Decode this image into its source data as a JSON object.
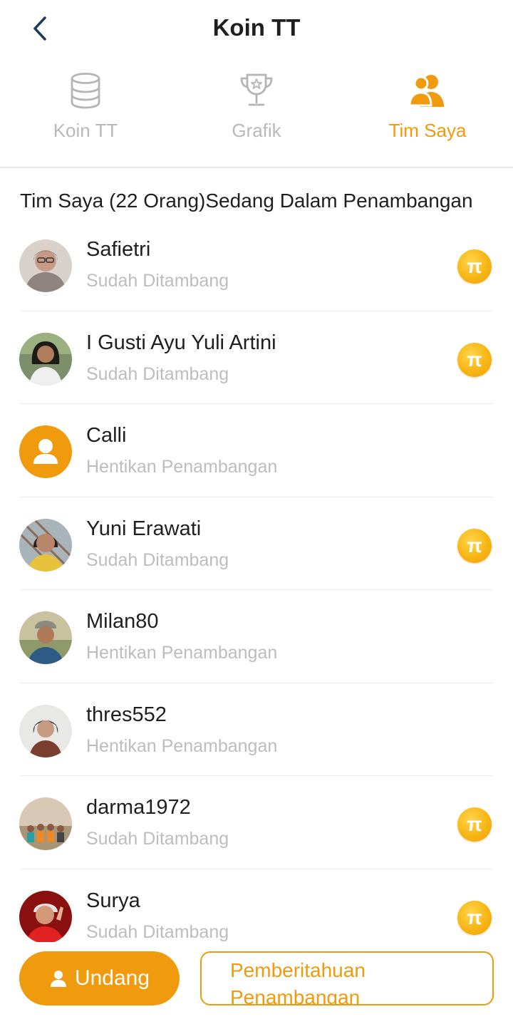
{
  "header": {
    "title": "Koin TT",
    "back_icon": "chevron-left-icon"
  },
  "tabs": [
    {
      "label": "Koin TT",
      "icon": "database-icon",
      "active": false
    },
    {
      "label": "Grafik",
      "icon": "trophy-icon",
      "active": false
    },
    {
      "label": "Tim Saya",
      "icon": "users-icon",
      "active": true
    }
  ],
  "team": {
    "summary": "Tim Saya (22 Orang)Sedang Dalam Penambangan"
  },
  "members": [
    {
      "name": "Safietri",
      "status": "Sudah Ditambang",
      "coin": true
    },
    {
      "name": "I Gusti Ayu Yuli Artini",
      "status": "Sudah Ditambang",
      "coin": true
    },
    {
      "name": "Calli",
      "status": "Hentikan Penambangan",
      "coin": false
    },
    {
      "name": "Yuni Erawati",
      "status": "Sudah Ditambang",
      "coin": true
    },
    {
      "name": "Milan80",
      "status": "Hentikan Penambangan",
      "coin": false
    },
    {
      "name": "thres552",
      "status": "Hentikan Penambangan",
      "coin": false
    },
    {
      "name": "darma1972",
      "status": "Sudah Ditambang",
      "coin": true
    },
    {
      "name": "Surya",
      "status": "Sudah Ditambang",
      "coin": true
    }
  ],
  "coin_symbol": "π",
  "actions": {
    "invite_label": "Undang",
    "notify_label": "Pemberitahuan Penambangan"
  },
  "colors": {
    "accent": "#f09a0d",
    "muted": "#bdbdbd",
    "text": "#1f1f1f"
  }
}
